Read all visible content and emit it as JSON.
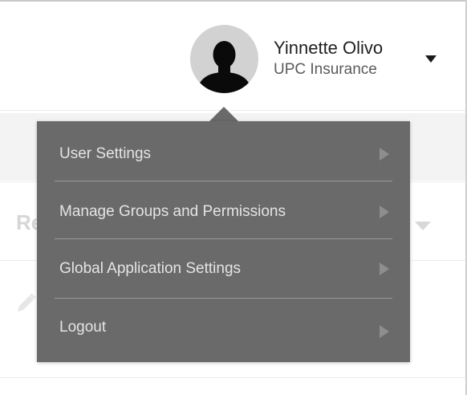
{
  "user": {
    "name": "Yinnette Olivo",
    "organization": "UPC Insurance",
    "avatar_icon": "person-silhouette-icon",
    "dropdown_icon": "caret-down-icon"
  },
  "background": {
    "partial_text": "Re"
  },
  "menu": {
    "items": [
      {
        "label": "User Settings",
        "icon": "chevron-right-icon"
      },
      {
        "label": "Manage Groups and Permissions",
        "icon": "chevron-right-icon"
      },
      {
        "label": "Global Application Settings",
        "icon": "chevron-right-icon"
      },
      {
        "label": "Logout",
        "icon": "chevron-right-icon"
      }
    ]
  },
  "colors": {
    "menu_background": "#6a6a6a",
    "menu_text": "#e4e4e4",
    "avatar_background": "#d2d2d2"
  }
}
